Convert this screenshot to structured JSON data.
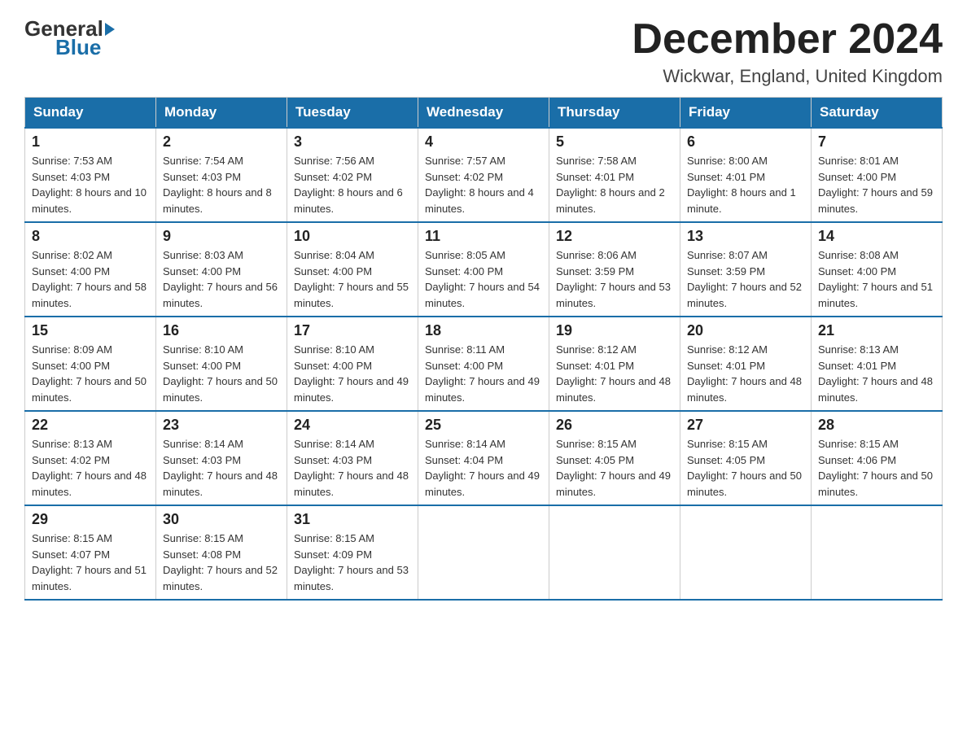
{
  "header": {
    "title": "December 2024",
    "location": "Wickwar, England, United Kingdom",
    "logo_general": "General",
    "logo_blue": "Blue"
  },
  "days_of_week": [
    "Sunday",
    "Monday",
    "Tuesday",
    "Wednesday",
    "Thursday",
    "Friday",
    "Saturday"
  ],
  "weeks": [
    [
      {
        "day": "1",
        "sunrise": "7:53 AM",
        "sunset": "4:03 PM",
        "daylight": "8 hours and 10 minutes."
      },
      {
        "day": "2",
        "sunrise": "7:54 AM",
        "sunset": "4:03 PM",
        "daylight": "8 hours and 8 minutes."
      },
      {
        "day": "3",
        "sunrise": "7:56 AM",
        "sunset": "4:02 PM",
        "daylight": "8 hours and 6 minutes."
      },
      {
        "day": "4",
        "sunrise": "7:57 AM",
        "sunset": "4:02 PM",
        "daylight": "8 hours and 4 minutes."
      },
      {
        "day": "5",
        "sunrise": "7:58 AM",
        "sunset": "4:01 PM",
        "daylight": "8 hours and 2 minutes."
      },
      {
        "day": "6",
        "sunrise": "8:00 AM",
        "sunset": "4:01 PM",
        "daylight": "8 hours and 1 minute."
      },
      {
        "day": "7",
        "sunrise": "8:01 AM",
        "sunset": "4:00 PM",
        "daylight": "7 hours and 59 minutes."
      }
    ],
    [
      {
        "day": "8",
        "sunrise": "8:02 AM",
        "sunset": "4:00 PM",
        "daylight": "7 hours and 58 minutes."
      },
      {
        "day": "9",
        "sunrise": "8:03 AM",
        "sunset": "4:00 PM",
        "daylight": "7 hours and 56 minutes."
      },
      {
        "day": "10",
        "sunrise": "8:04 AM",
        "sunset": "4:00 PM",
        "daylight": "7 hours and 55 minutes."
      },
      {
        "day": "11",
        "sunrise": "8:05 AM",
        "sunset": "4:00 PM",
        "daylight": "7 hours and 54 minutes."
      },
      {
        "day": "12",
        "sunrise": "8:06 AM",
        "sunset": "3:59 PM",
        "daylight": "7 hours and 53 minutes."
      },
      {
        "day": "13",
        "sunrise": "8:07 AM",
        "sunset": "3:59 PM",
        "daylight": "7 hours and 52 minutes."
      },
      {
        "day": "14",
        "sunrise": "8:08 AM",
        "sunset": "4:00 PM",
        "daylight": "7 hours and 51 minutes."
      }
    ],
    [
      {
        "day": "15",
        "sunrise": "8:09 AM",
        "sunset": "4:00 PM",
        "daylight": "7 hours and 50 minutes."
      },
      {
        "day": "16",
        "sunrise": "8:10 AM",
        "sunset": "4:00 PM",
        "daylight": "7 hours and 50 minutes."
      },
      {
        "day": "17",
        "sunrise": "8:10 AM",
        "sunset": "4:00 PM",
        "daylight": "7 hours and 49 minutes."
      },
      {
        "day": "18",
        "sunrise": "8:11 AM",
        "sunset": "4:00 PM",
        "daylight": "7 hours and 49 minutes."
      },
      {
        "day": "19",
        "sunrise": "8:12 AM",
        "sunset": "4:01 PM",
        "daylight": "7 hours and 48 minutes."
      },
      {
        "day": "20",
        "sunrise": "8:12 AM",
        "sunset": "4:01 PM",
        "daylight": "7 hours and 48 minutes."
      },
      {
        "day": "21",
        "sunrise": "8:13 AM",
        "sunset": "4:01 PM",
        "daylight": "7 hours and 48 minutes."
      }
    ],
    [
      {
        "day": "22",
        "sunrise": "8:13 AM",
        "sunset": "4:02 PM",
        "daylight": "7 hours and 48 minutes."
      },
      {
        "day": "23",
        "sunrise": "8:14 AM",
        "sunset": "4:03 PM",
        "daylight": "7 hours and 48 minutes."
      },
      {
        "day": "24",
        "sunrise": "8:14 AM",
        "sunset": "4:03 PM",
        "daylight": "7 hours and 48 minutes."
      },
      {
        "day": "25",
        "sunrise": "8:14 AM",
        "sunset": "4:04 PM",
        "daylight": "7 hours and 49 minutes."
      },
      {
        "day": "26",
        "sunrise": "8:15 AM",
        "sunset": "4:05 PM",
        "daylight": "7 hours and 49 minutes."
      },
      {
        "day": "27",
        "sunrise": "8:15 AM",
        "sunset": "4:05 PM",
        "daylight": "7 hours and 50 minutes."
      },
      {
        "day": "28",
        "sunrise": "8:15 AM",
        "sunset": "4:06 PM",
        "daylight": "7 hours and 50 minutes."
      }
    ],
    [
      {
        "day": "29",
        "sunrise": "8:15 AM",
        "sunset": "4:07 PM",
        "daylight": "7 hours and 51 minutes."
      },
      {
        "day": "30",
        "sunrise": "8:15 AM",
        "sunset": "4:08 PM",
        "daylight": "7 hours and 52 minutes."
      },
      {
        "day": "31",
        "sunrise": "8:15 AM",
        "sunset": "4:09 PM",
        "daylight": "7 hours and 53 minutes."
      },
      null,
      null,
      null,
      null
    ]
  ]
}
